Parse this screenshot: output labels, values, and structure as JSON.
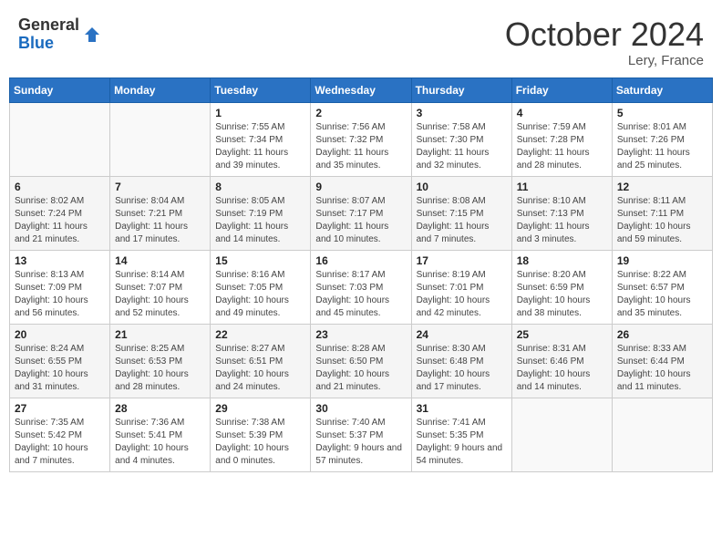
{
  "logo": {
    "general": "General",
    "blue": "Blue"
  },
  "title": "October 2024",
  "location": "Lery, France",
  "days_header": [
    "Sunday",
    "Monday",
    "Tuesday",
    "Wednesday",
    "Thursday",
    "Friday",
    "Saturday"
  ],
  "weeks": [
    [
      {
        "day": "",
        "sunrise": "",
        "sunset": "",
        "daylight": ""
      },
      {
        "day": "",
        "sunrise": "",
        "sunset": "",
        "daylight": ""
      },
      {
        "day": "1",
        "sunrise": "Sunrise: 7:55 AM",
        "sunset": "Sunset: 7:34 PM",
        "daylight": "Daylight: 11 hours and 39 minutes."
      },
      {
        "day": "2",
        "sunrise": "Sunrise: 7:56 AM",
        "sunset": "Sunset: 7:32 PM",
        "daylight": "Daylight: 11 hours and 35 minutes."
      },
      {
        "day": "3",
        "sunrise": "Sunrise: 7:58 AM",
        "sunset": "Sunset: 7:30 PM",
        "daylight": "Daylight: 11 hours and 32 minutes."
      },
      {
        "day": "4",
        "sunrise": "Sunrise: 7:59 AM",
        "sunset": "Sunset: 7:28 PM",
        "daylight": "Daylight: 11 hours and 28 minutes."
      },
      {
        "day": "5",
        "sunrise": "Sunrise: 8:01 AM",
        "sunset": "Sunset: 7:26 PM",
        "daylight": "Daylight: 11 hours and 25 minutes."
      }
    ],
    [
      {
        "day": "6",
        "sunrise": "Sunrise: 8:02 AM",
        "sunset": "Sunset: 7:24 PM",
        "daylight": "Daylight: 11 hours and 21 minutes."
      },
      {
        "day": "7",
        "sunrise": "Sunrise: 8:04 AM",
        "sunset": "Sunset: 7:21 PM",
        "daylight": "Daylight: 11 hours and 17 minutes."
      },
      {
        "day": "8",
        "sunrise": "Sunrise: 8:05 AM",
        "sunset": "Sunset: 7:19 PM",
        "daylight": "Daylight: 11 hours and 14 minutes."
      },
      {
        "day": "9",
        "sunrise": "Sunrise: 8:07 AM",
        "sunset": "Sunset: 7:17 PM",
        "daylight": "Daylight: 11 hours and 10 minutes."
      },
      {
        "day": "10",
        "sunrise": "Sunrise: 8:08 AM",
        "sunset": "Sunset: 7:15 PM",
        "daylight": "Daylight: 11 hours and 7 minutes."
      },
      {
        "day": "11",
        "sunrise": "Sunrise: 8:10 AM",
        "sunset": "Sunset: 7:13 PM",
        "daylight": "Daylight: 11 hours and 3 minutes."
      },
      {
        "day": "12",
        "sunrise": "Sunrise: 8:11 AM",
        "sunset": "Sunset: 7:11 PM",
        "daylight": "Daylight: 10 hours and 59 minutes."
      }
    ],
    [
      {
        "day": "13",
        "sunrise": "Sunrise: 8:13 AM",
        "sunset": "Sunset: 7:09 PM",
        "daylight": "Daylight: 10 hours and 56 minutes."
      },
      {
        "day": "14",
        "sunrise": "Sunrise: 8:14 AM",
        "sunset": "Sunset: 7:07 PM",
        "daylight": "Daylight: 10 hours and 52 minutes."
      },
      {
        "day": "15",
        "sunrise": "Sunrise: 8:16 AM",
        "sunset": "Sunset: 7:05 PM",
        "daylight": "Daylight: 10 hours and 49 minutes."
      },
      {
        "day": "16",
        "sunrise": "Sunrise: 8:17 AM",
        "sunset": "Sunset: 7:03 PM",
        "daylight": "Daylight: 10 hours and 45 minutes."
      },
      {
        "day": "17",
        "sunrise": "Sunrise: 8:19 AM",
        "sunset": "Sunset: 7:01 PM",
        "daylight": "Daylight: 10 hours and 42 minutes."
      },
      {
        "day": "18",
        "sunrise": "Sunrise: 8:20 AM",
        "sunset": "Sunset: 6:59 PM",
        "daylight": "Daylight: 10 hours and 38 minutes."
      },
      {
        "day": "19",
        "sunrise": "Sunrise: 8:22 AM",
        "sunset": "Sunset: 6:57 PM",
        "daylight": "Daylight: 10 hours and 35 minutes."
      }
    ],
    [
      {
        "day": "20",
        "sunrise": "Sunrise: 8:24 AM",
        "sunset": "Sunset: 6:55 PM",
        "daylight": "Daylight: 10 hours and 31 minutes."
      },
      {
        "day": "21",
        "sunrise": "Sunrise: 8:25 AM",
        "sunset": "Sunset: 6:53 PM",
        "daylight": "Daylight: 10 hours and 28 minutes."
      },
      {
        "day": "22",
        "sunrise": "Sunrise: 8:27 AM",
        "sunset": "Sunset: 6:51 PM",
        "daylight": "Daylight: 10 hours and 24 minutes."
      },
      {
        "day": "23",
        "sunrise": "Sunrise: 8:28 AM",
        "sunset": "Sunset: 6:50 PM",
        "daylight": "Daylight: 10 hours and 21 minutes."
      },
      {
        "day": "24",
        "sunrise": "Sunrise: 8:30 AM",
        "sunset": "Sunset: 6:48 PM",
        "daylight": "Daylight: 10 hours and 17 minutes."
      },
      {
        "day": "25",
        "sunrise": "Sunrise: 8:31 AM",
        "sunset": "Sunset: 6:46 PM",
        "daylight": "Daylight: 10 hours and 14 minutes."
      },
      {
        "day": "26",
        "sunrise": "Sunrise: 8:33 AM",
        "sunset": "Sunset: 6:44 PM",
        "daylight": "Daylight: 10 hours and 11 minutes."
      }
    ],
    [
      {
        "day": "27",
        "sunrise": "Sunrise: 7:35 AM",
        "sunset": "Sunset: 5:42 PM",
        "daylight": "Daylight: 10 hours and 7 minutes."
      },
      {
        "day": "28",
        "sunrise": "Sunrise: 7:36 AM",
        "sunset": "Sunset: 5:41 PM",
        "daylight": "Daylight: 10 hours and 4 minutes."
      },
      {
        "day": "29",
        "sunrise": "Sunrise: 7:38 AM",
        "sunset": "Sunset: 5:39 PM",
        "daylight": "Daylight: 10 hours and 0 minutes."
      },
      {
        "day": "30",
        "sunrise": "Sunrise: 7:40 AM",
        "sunset": "Sunset: 5:37 PM",
        "daylight": "Daylight: 9 hours and 57 minutes."
      },
      {
        "day": "31",
        "sunrise": "Sunrise: 7:41 AM",
        "sunset": "Sunset: 5:35 PM",
        "daylight": "Daylight: 9 hours and 54 minutes."
      },
      {
        "day": "",
        "sunrise": "",
        "sunset": "",
        "daylight": ""
      },
      {
        "day": "",
        "sunrise": "",
        "sunset": "",
        "daylight": ""
      }
    ]
  ]
}
